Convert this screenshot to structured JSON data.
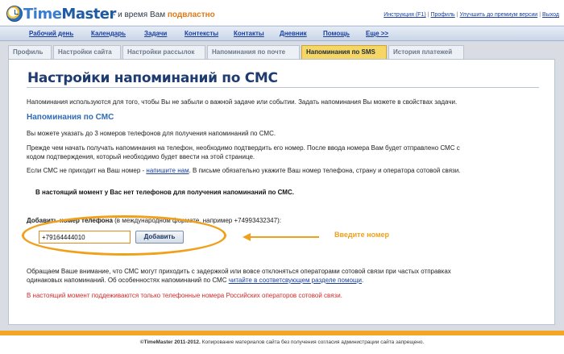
{
  "header": {
    "logo_time": "Time",
    "logo_master": "Master",
    "tagline_prefix": "- и время Вам ",
    "tagline_emph": "подвластно",
    "links": [
      "Инструкция (F1)",
      "Профиль",
      "Улучшить до премиум версии",
      "Выход"
    ],
    "separator": "|"
  },
  "nav": {
    "items": [
      "Рабочий день",
      "Календарь",
      "Задачи",
      "Контексты",
      "Контакты",
      "Дневник",
      "Помощь",
      "Еще >>"
    ]
  },
  "tabs": {
    "items": [
      "Профиль",
      "Настройки сайта",
      "Настройки рассылок",
      "Напоминания по почте",
      "Напоминания по SMS",
      "История платежей"
    ],
    "active": "Напоминания по SMS"
  },
  "main": {
    "title": "Настройки напоминаний по СМС",
    "intro": "Напоминания используются для того, чтобы Вы не забыли о важной задаче или событии. Задать напоминания Вы можете в свойствах задачи.",
    "subhead": "Напоминания по СМС",
    "p1": "Вы можете указать до 3 номеров телефонов для получения напоминаний по СМС.",
    "p2_line1": "Прежде чем начать получать напоминания на телефон, необходимо подтвердить его номер. После ввода номера Вам будет отправлено СМС с",
    "p2_line2": "кодом подтверждения, который необходимо будет ввести на этой странице.",
    "p3_prefix": "Если СМС не приходит на Ваш номер - ",
    "p3_link": "напишите нам",
    "p3_suffix": ". В письме обязательно укажите Ваш номер телефона, страну и оператора сотовой связи.",
    "notice": "В настоящий момент у Вас нет телефонов для получения напоминаний по СМС.",
    "add_label_bold": "Добавить номер телефона",
    "add_label_rest": " (в международном формате, например +74993432347):",
    "phone_value": "+79164444010",
    "add_button": "Добавить",
    "hint": "Введите номер",
    "warn_line1": "Обращаем Ваше внимание, что СМС могут приходить с задержкой или вовсе отклоняться операторами сотовой связи при частых отправках",
    "warn_line2_prefix": "одинаковых напоминаний. Об особенностях напоминаний по СМС ",
    "warn_link": "читайте в соответсвующем разделе помощи",
    "warn_line2_suffix": ".",
    "red_note": "В настоящий момент поддеживаются только телефонные номера Российских операторов сотовой связи."
  },
  "footer": {
    "brand": "©TimeMaster 2011-2012.",
    "text": " Копирование материалов сайта без получения согласия администрации сайта запрещено."
  },
  "colors": {
    "accent": "#f0a11c",
    "active_tab": "#f6d766",
    "link": "#1a3f9c",
    "title": "#1f3c70",
    "warning": "#d32a2a"
  }
}
